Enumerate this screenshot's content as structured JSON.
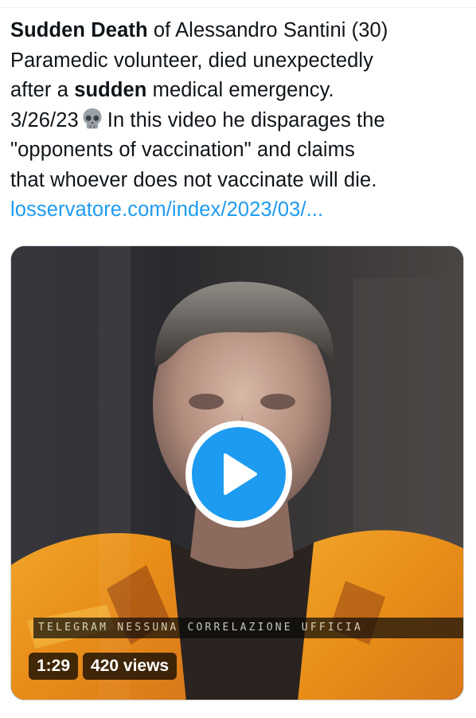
{
  "tweet": {
    "lines": [
      [
        {
          "text": "Sudden Death",
          "bold": true
        },
        {
          "text": " of Alessandro Santini (30)",
          "bold": false
        }
      ],
      [
        {
          "text": "Paramedic volunteer, died unexpectedly",
          "bold": false
        }
      ],
      [
        {
          "text": "after a ",
          "bold": false
        },
        {
          "text": "sudden",
          "bold": true
        },
        {
          "text": " medical emergency.",
          "bold": false
        }
      ],
      [
        {
          "text": "3/26/23",
          "bold": false
        },
        {
          "emoji": "skull-emoji"
        },
        {
          "text": "In this video he disparages the",
          "bold": false
        }
      ],
      [
        {
          "text": "\"opponents of vaccination\" and claims",
          "bold": false
        }
      ],
      [
        {
          "text": "that whoever does not vaccinate will die.",
          "bold": false
        }
      ]
    ],
    "link": "losservatore.com/index/2023/03/..."
  },
  "video": {
    "overlay_caption": "TELEGRAM NESSUNA CORRELAZIONE UFFICIA",
    "duration": "1:29",
    "views": "420 views",
    "play_icon": "play-icon"
  },
  "colors": {
    "link": "#1d9bf0",
    "play_button": "#1d9bf0",
    "text": "#0f1419"
  }
}
